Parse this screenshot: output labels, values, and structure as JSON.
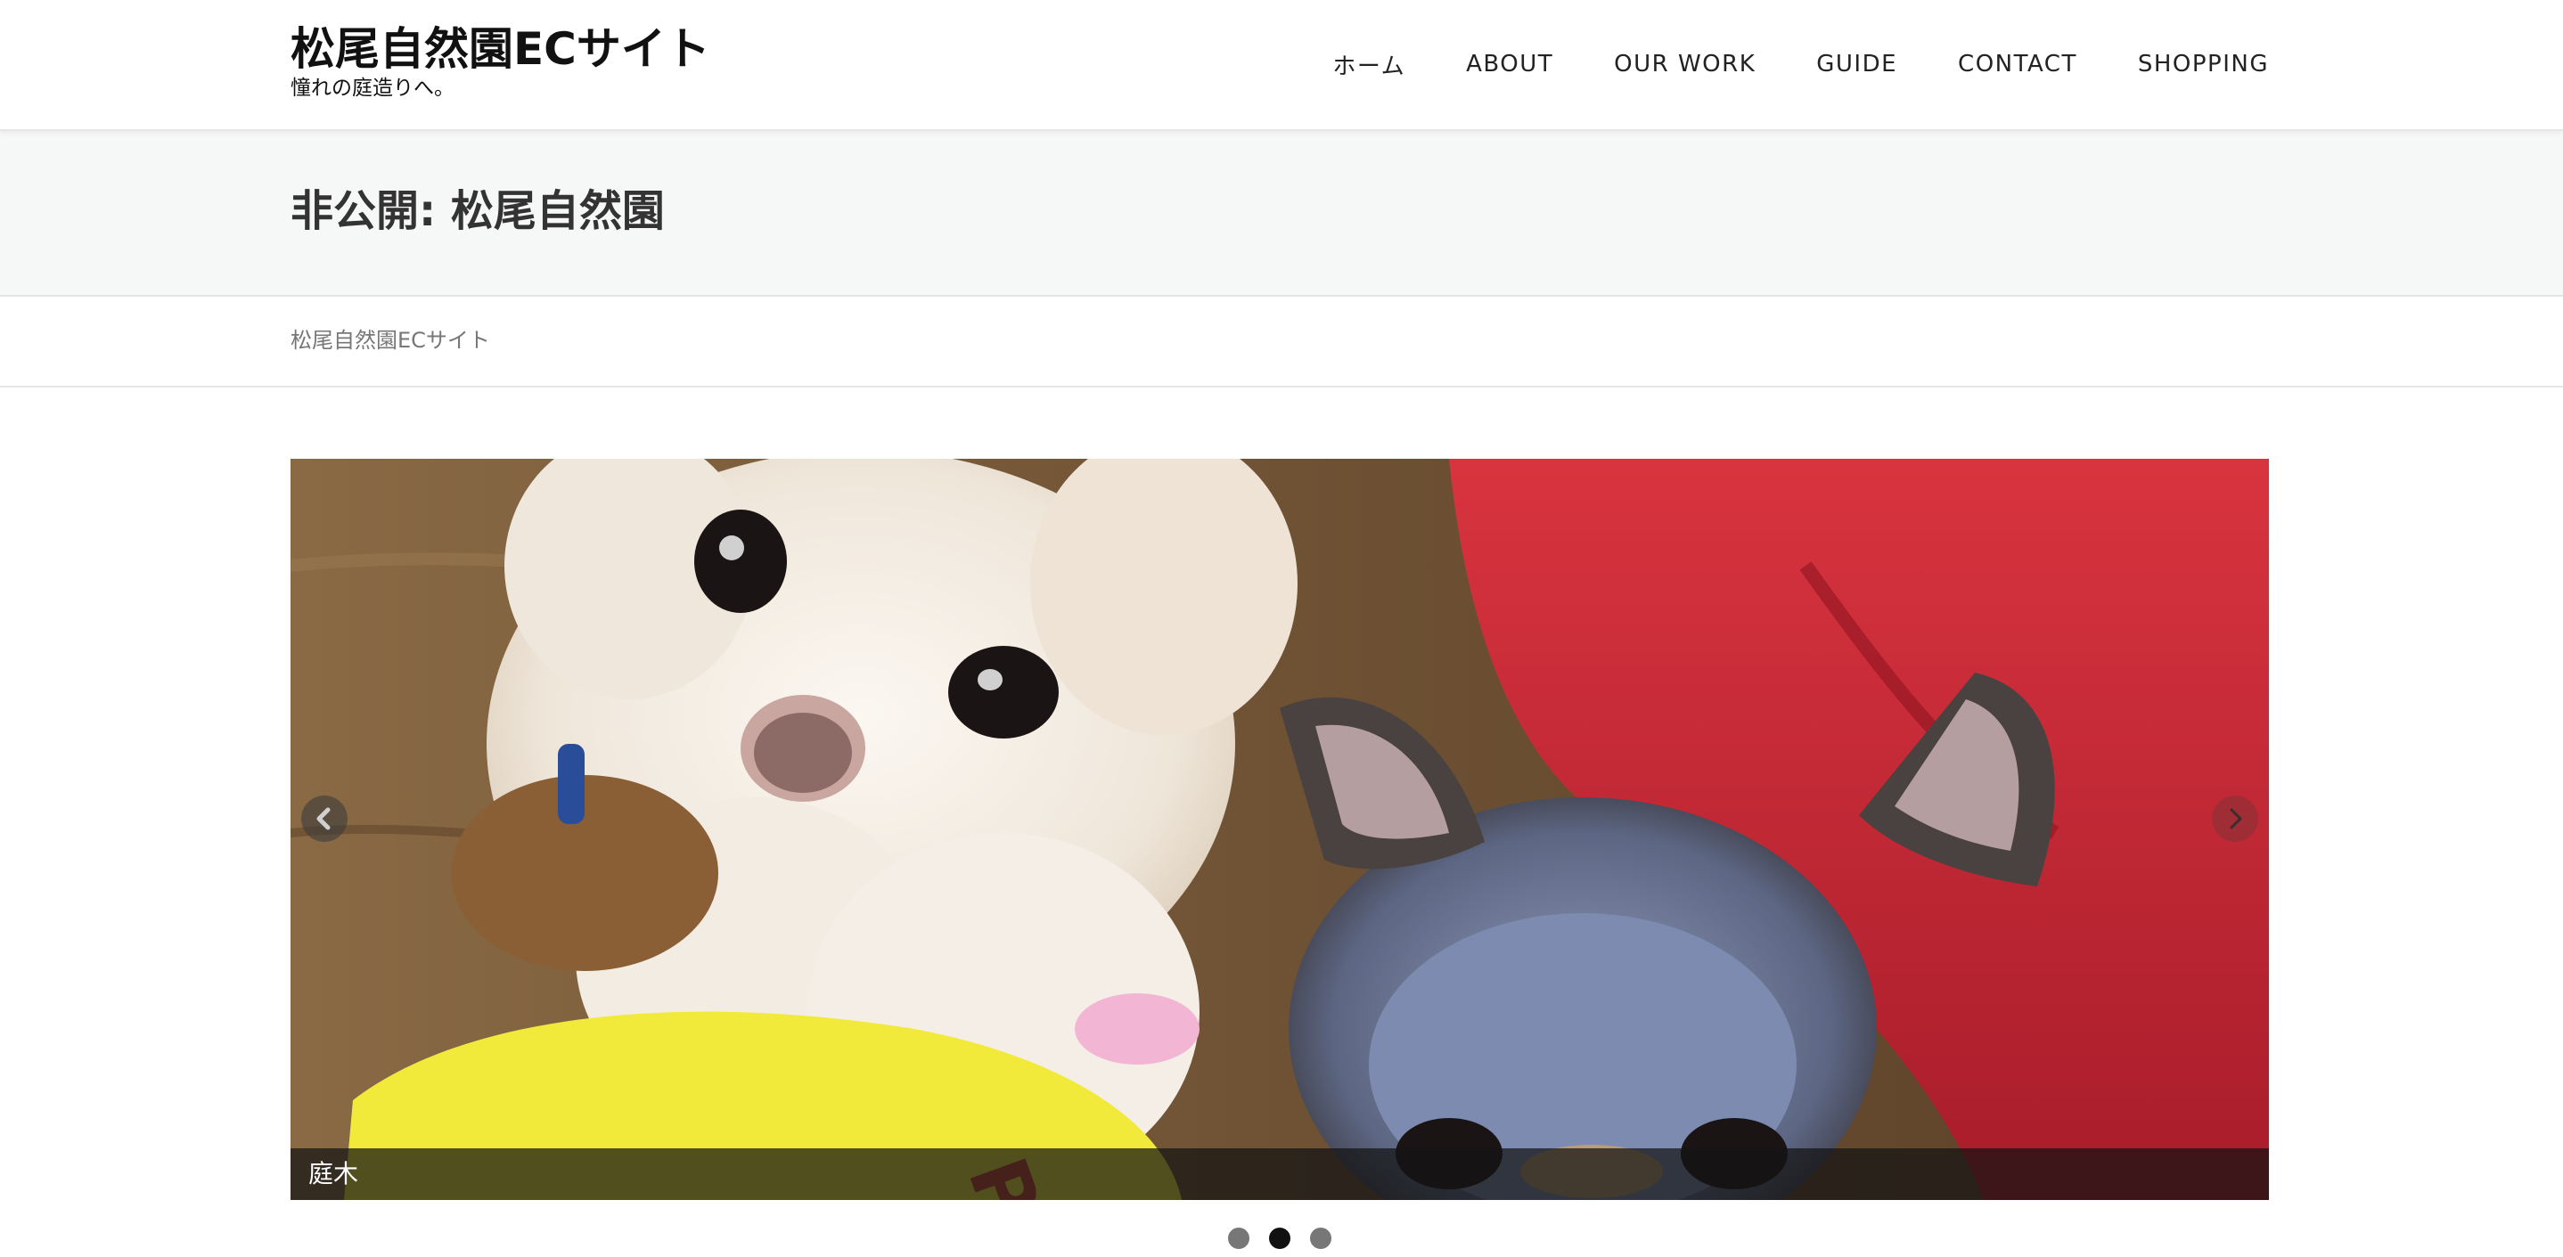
{
  "header": {
    "site_title": "松尾自然園ECサイト",
    "tagline": "憧れの庭造りへ。",
    "nav": [
      {
        "label": "ホーム"
      },
      {
        "label": "ABOUT"
      },
      {
        "label": "OUR WORK"
      },
      {
        "label": "GUIDE"
      },
      {
        "label": "CONTACT"
      },
      {
        "label": "SHOPPING"
      }
    ]
  },
  "page": {
    "title": "非公開: 松尾自然園",
    "breadcrumb": "松尾自然園ECサイト"
  },
  "slider": {
    "caption": "庭木",
    "prev_icon": "chevron-left-icon",
    "next_icon": "chevron-right-icon",
    "slide_count": 3,
    "active_index": 1
  },
  "colors": {
    "header_bg": "#ffffff",
    "title_band_bg": "#f6f7f7",
    "text_dark": "#333333",
    "breadcrumb_text": "#777777",
    "dot_inactive": "#777777",
    "dot_active": "#111111"
  }
}
